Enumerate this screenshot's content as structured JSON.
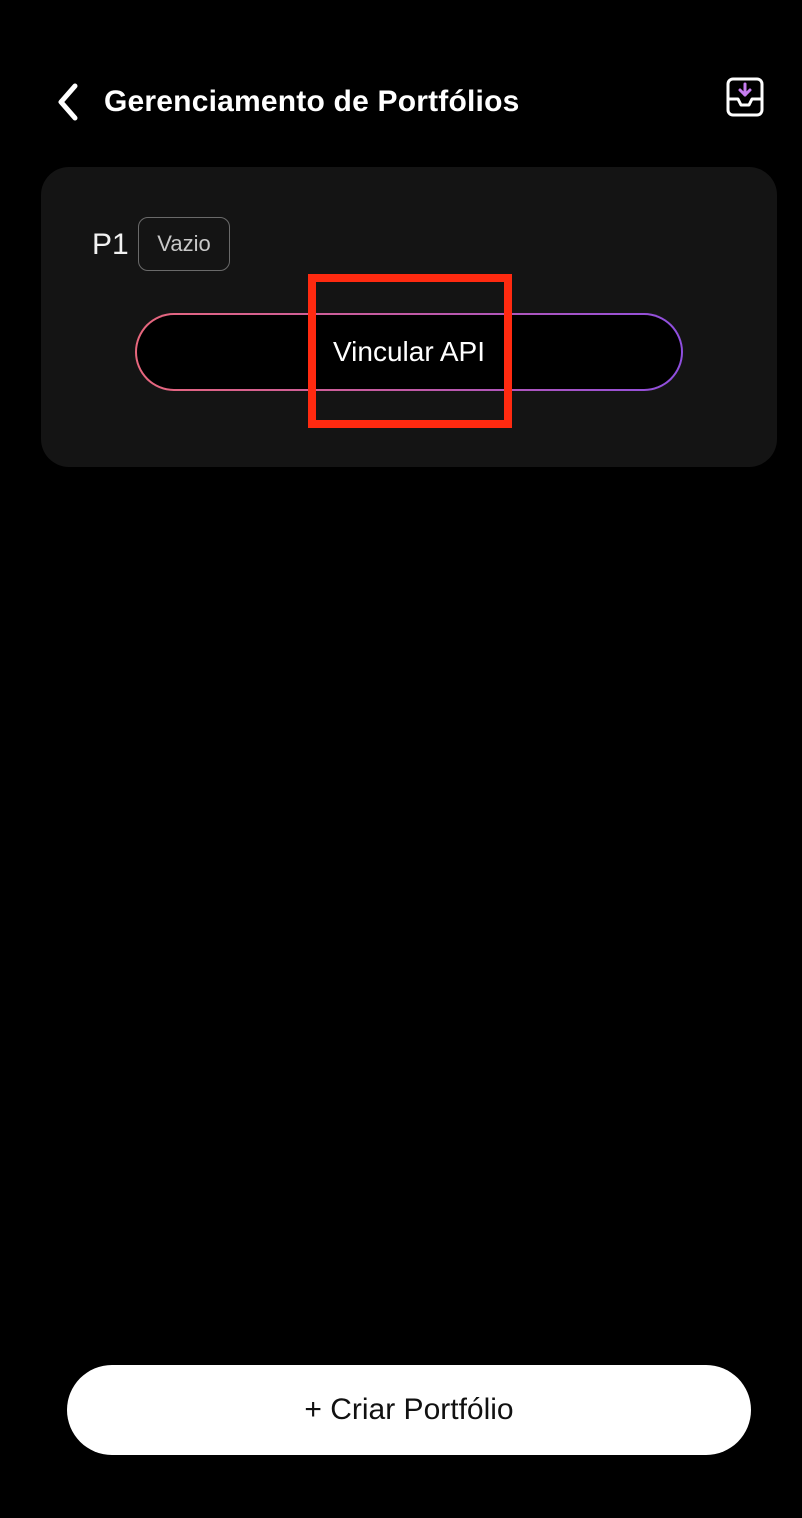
{
  "header": {
    "title": "Gerenciamento de Portfólios",
    "back_icon": "chevron-left-icon",
    "import_icon": "tray-download-icon"
  },
  "portfolio_card": {
    "name": "P1",
    "status_badge": "Vazio",
    "link_api_label": "Vincular API"
  },
  "footer": {
    "create_label": "+ Criar Portfólio"
  },
  "colors": {
    "background": "#000000",
    "card": "#141414",
    "gradient_start": "#e8677d",
    "gradient_end": "#8f4fe0",
    "highlight": "#ff2a10",
    "primary_button": "#ffffff"
  }
}
